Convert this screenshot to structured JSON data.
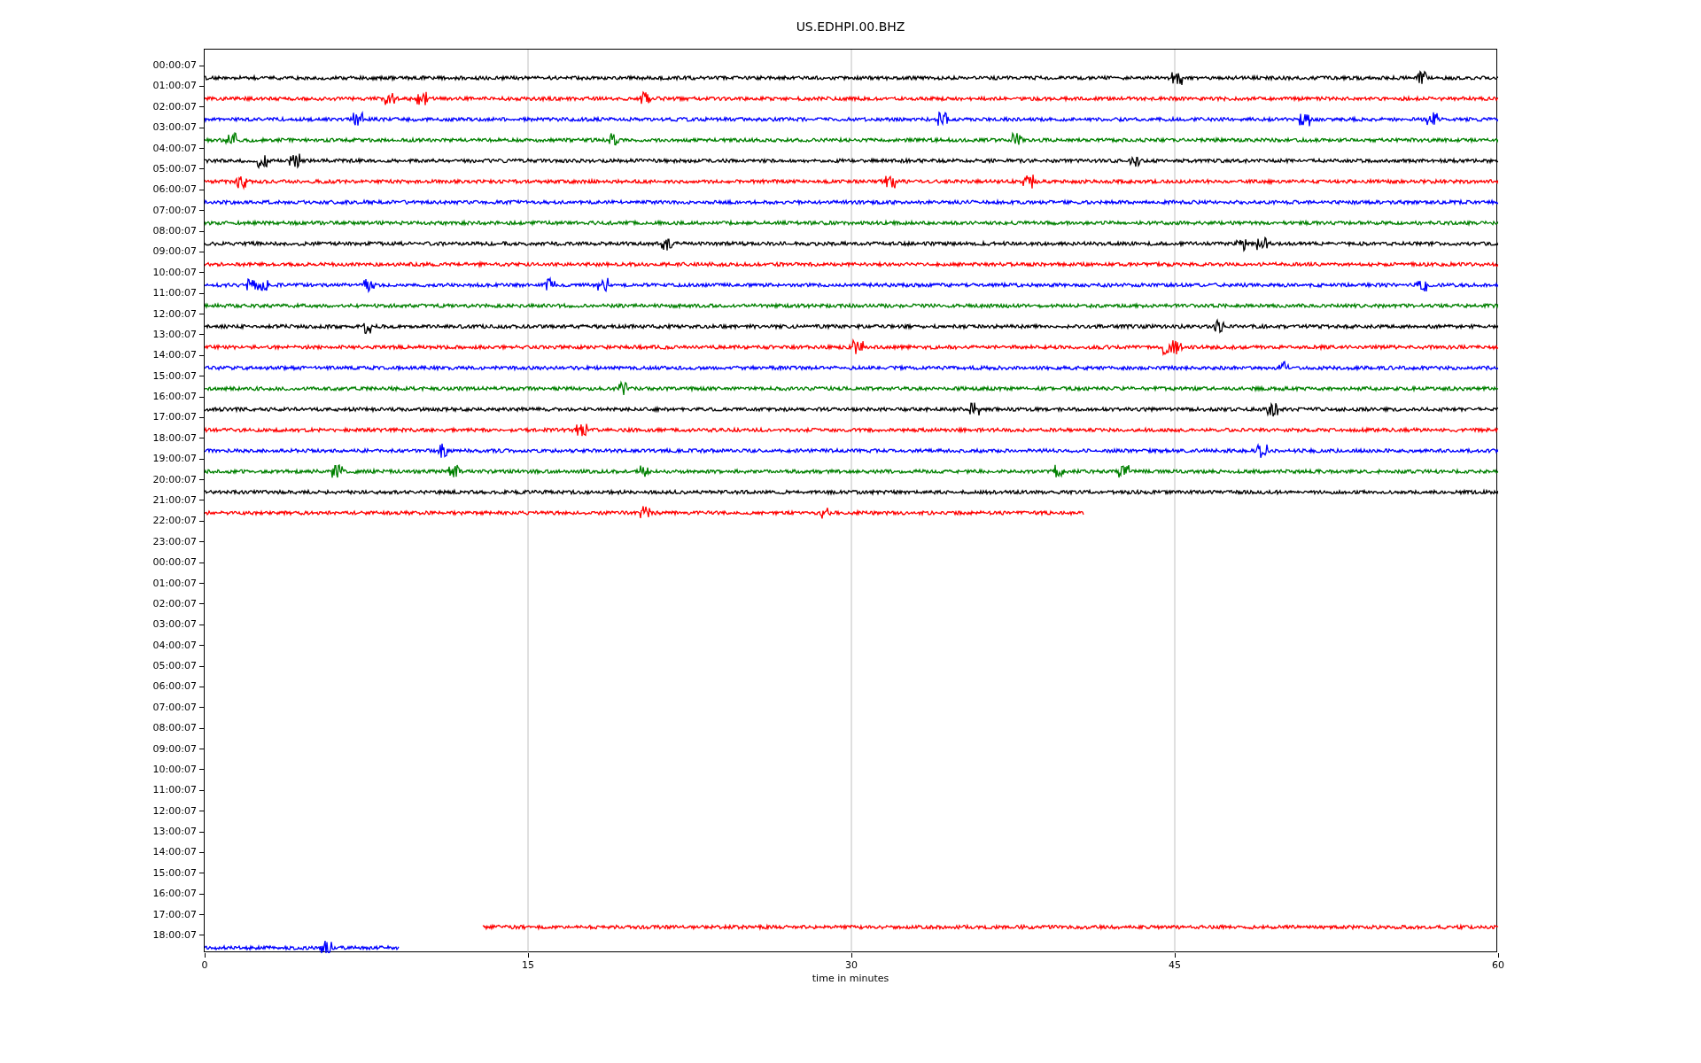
{
  "title": "US.EDHPI.00.BHZ",
  "xlabel": "time in minutes",
  "xticks": [
    "0",
    "15",
    "30",
    "45",
    "60"
  ],
  "rows": [
    {
      "label": "00:00:07",
      "trace": {
        "color": "#000000",
        "level": 1
      }
    },
    {
      "label": "01:00:07",
      "trace": {
        "color": "#ff0000",
        "level": 1
      }
    },
    {
      "label": "02:00:07",
      "trace": {
        "color": "#0000ff",
        "level": 1
      }
    },
    {
      "label": "03:00:07",
      "trace": {
        "color": "#008000",
        "level": 1
      }
    },
    {
      "label": "04:00:07",
      "trace": {
        "color": "#000000",
        "level": 1
      }
    },
    {
      "label": "05:00:07",
      "trace": {
        "color": "#ff0000",
        "level": 1
      }
    },
    {
      "label": "06:00:07",
      "trace": {
        "color": "#0000ff",
        "level": 1
      }
    },
    {
      "label": "07:00:07",
      "trace": {
        "color": "#008000",
        "level": 1
      }
    },
    {
      "label": "08:00:07",
      "trace": {
        "color": "#000000",
        "level": 1
      }
    },
    {
      "label": "09:00:07",
      "trace": {
        "color": "#ff0000",
        "level": 1
      }
    },
    {
      "label": "10:00:07",
      "trace": {
        "color": "#0000ff",
        "level": 1
      }
    },
    {
      "label": "11:00:07",
      "trace": {
        "color": "#008000",
        "level": 1
      }
    },
    {
      "label": "12:00:07",
      "trace": {
        "color": "#000000",
        "level": 1
      }
    },
    {
      "label": "13:00:07",
      "trace": {
        "color": "#ff0000",
        "level": 1
      }
    },
    {
      "label": "14:00:07",
      "trace": {
        "color": "#0000ff",
        "level": 1
      }
    },
    {
      "label": "15:00:07",
      "trace": {
        "color": "#008000",
        "level": 1
      }
    },
    {
      "label": "16:00:07",
      "trace": {
        "color": "#000000",
        "level": 1
      }
    },
    {
      "label": "17:00:07",
      "trace": {
        "color": "#ff0000",
        "level": 1
      }
    },
    {
      "label": "18:00:07",
      "trace": {
        "color": "#0000ff",
        "level": 1
      }
    },
    {
      "label": "19:00:07",
      "trace": {
        "color": "#008000",
        "level": 1
      }
    },
    {
      "label": "20:00:07",
      "trace": {
        "color": "#000000",
        "level": 1
      }
    },
    {
      "label": "21:00:07",
      "trace": {
        "color": "#ff0000",
        "level": 0.68,
        "from_end": false
      }
    },
    {
      "label": "22:00:07"
    },
    {
      "label": "23:00:07"
    },
    {
      "label": "00:00:07"
    },
    {
      "label": "01:00:07"
    },
    {
      "label": "02:00:07"
    },
    {
      "label": "03:00:07"
    },
    {
      "label": "04:00:07"
    },
    {
      "label": "05:00:07"
    },
    {
      "label": "06:00:07"
    },
    {
      "label": "07:00:07"
    },
    {
      "label": "08:00:07"
    },
    {
      "label": "09:00:07"
    },
    {
      "label": "10:00:07"
    },
    {
      "label": "11:00:07"
    },
    {
      "label": "12:00:07"
    },
    {
      "label": "13:00:07"
    },
    {
      "label": "14:00:07"
    },
    {
      "label": "15:00:07"
    },
    {
      "label": "16:00:07"
    },
    {
      "label": "17:00:07",
      "trace": {
        "color": "#ff0000",
        "level": 0.785,
        "from_end": true
      }
    },
    {
      "label": "18:00:07",
      "trace": {
        "color": "#0000ff",
        "level": 0.15,
        "from_end": false
      }
    }
  ]
}
